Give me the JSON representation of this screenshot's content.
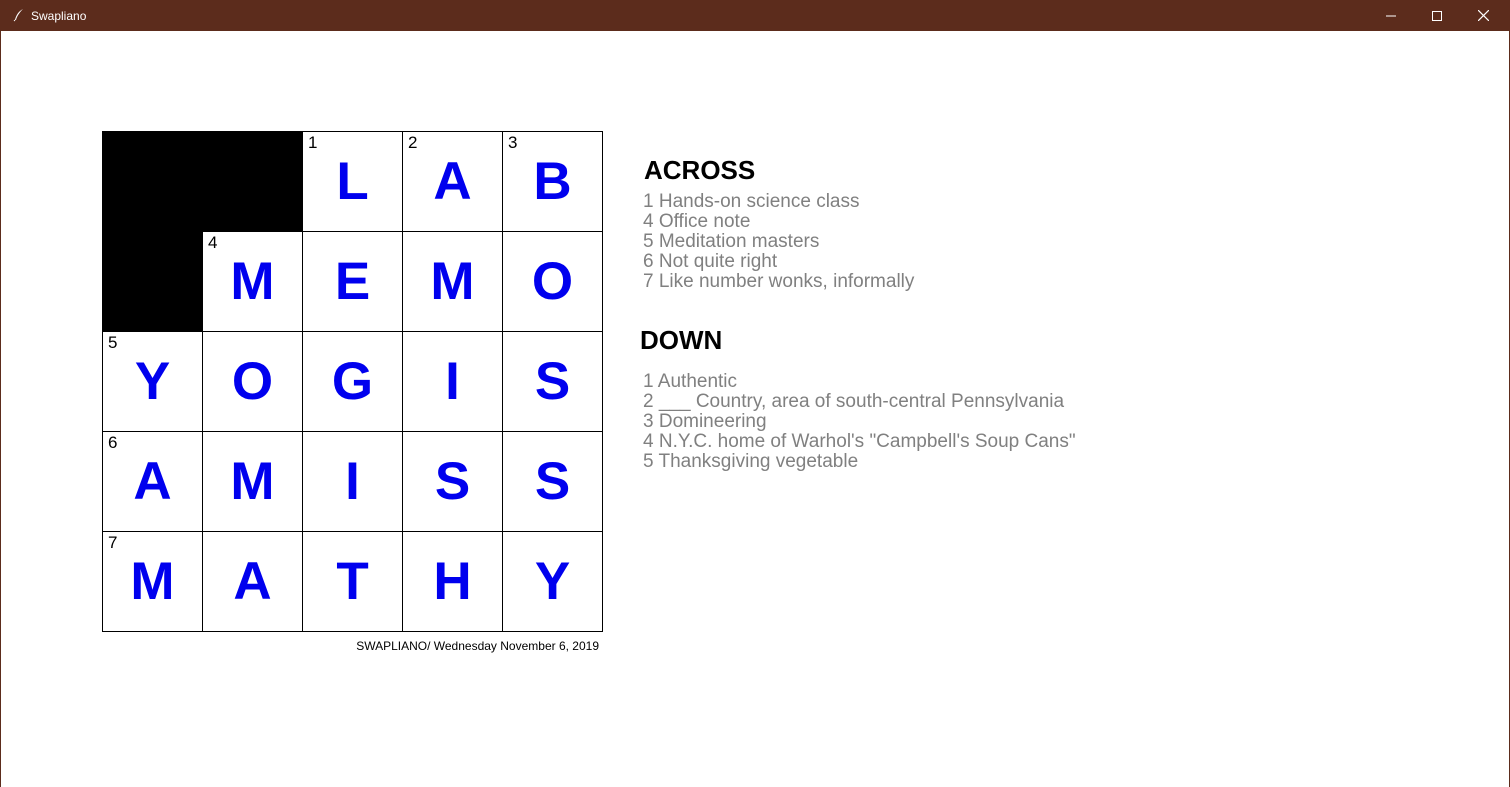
{
  "window": {
    "title": "Swapliano",
    "icon": "feather-icon",
    "titlebar_color": "#5c2c1c"
  },
  "puzzle": {
    "letter_color": "#0000ee",
    "rows": [
      [
        {
          "block": true
        },
        {
          "block": true
        },
        {
          "num": "1",
          "letter": "L"
        },
        {
          "num": "2",
          "letter": "A"
        },
        {
          "num": "3",
          "letter": "B"
        }
      ],
      [
        {
          "block": true
        },
        {
          "num": "4",
          "letter": "M"
        },
        {
          "letter": "E"
        },
        {
          "letter": "M"
        },
        {
          "letter": "O"
        }
      ],
      [
        {
          "num": "5",
          "letter": "Y"
        },
        {
          "letter": "O"
        },
        {
          "letter": "G"
        },
        {
          "letter": "I"
        },
        {
          "letter": "S"
        }
      ],
      [
        {
          "num": "6",
          "letter": "A"
        },
        {
          "letter": "M"
        },
        {
          "letter": "I"
        },
        {
          "letter": "S"
        },
        {
          "letter": "S"
        }
      ],
      [
        {
          "num": "7",
          "letter": "M"
        },
        {
          "letter": "A"
        },
        {
          "letter": "T"
        },
        {
          "letter": "H"
        },
        {
          "letter": "Y"
        }
      ]
    ],
    "caption": "SWAPLIANO/ Wednesday November 6, 2019"
  },
  "clues": {
    "across_heading": "ACROSS",
    "across": [
      "1 Hands-on science class",
      "4 Office note",
      "5 Meditation masters",
      "6 Not quite right",
      "7 Like number wonks, informally"
    ],
    "down_heading": "DOWN",
    "down": [
      "1 Authentic",
      "2 ___ Country, area of south-central Pennsylvania",
      "3 Domineering",
      "4 N.Y.C. home of Warhol's \"Campbell's Soup Cans\"",
      "5 Thanksgiving vegetable"
    ]
  }
}
